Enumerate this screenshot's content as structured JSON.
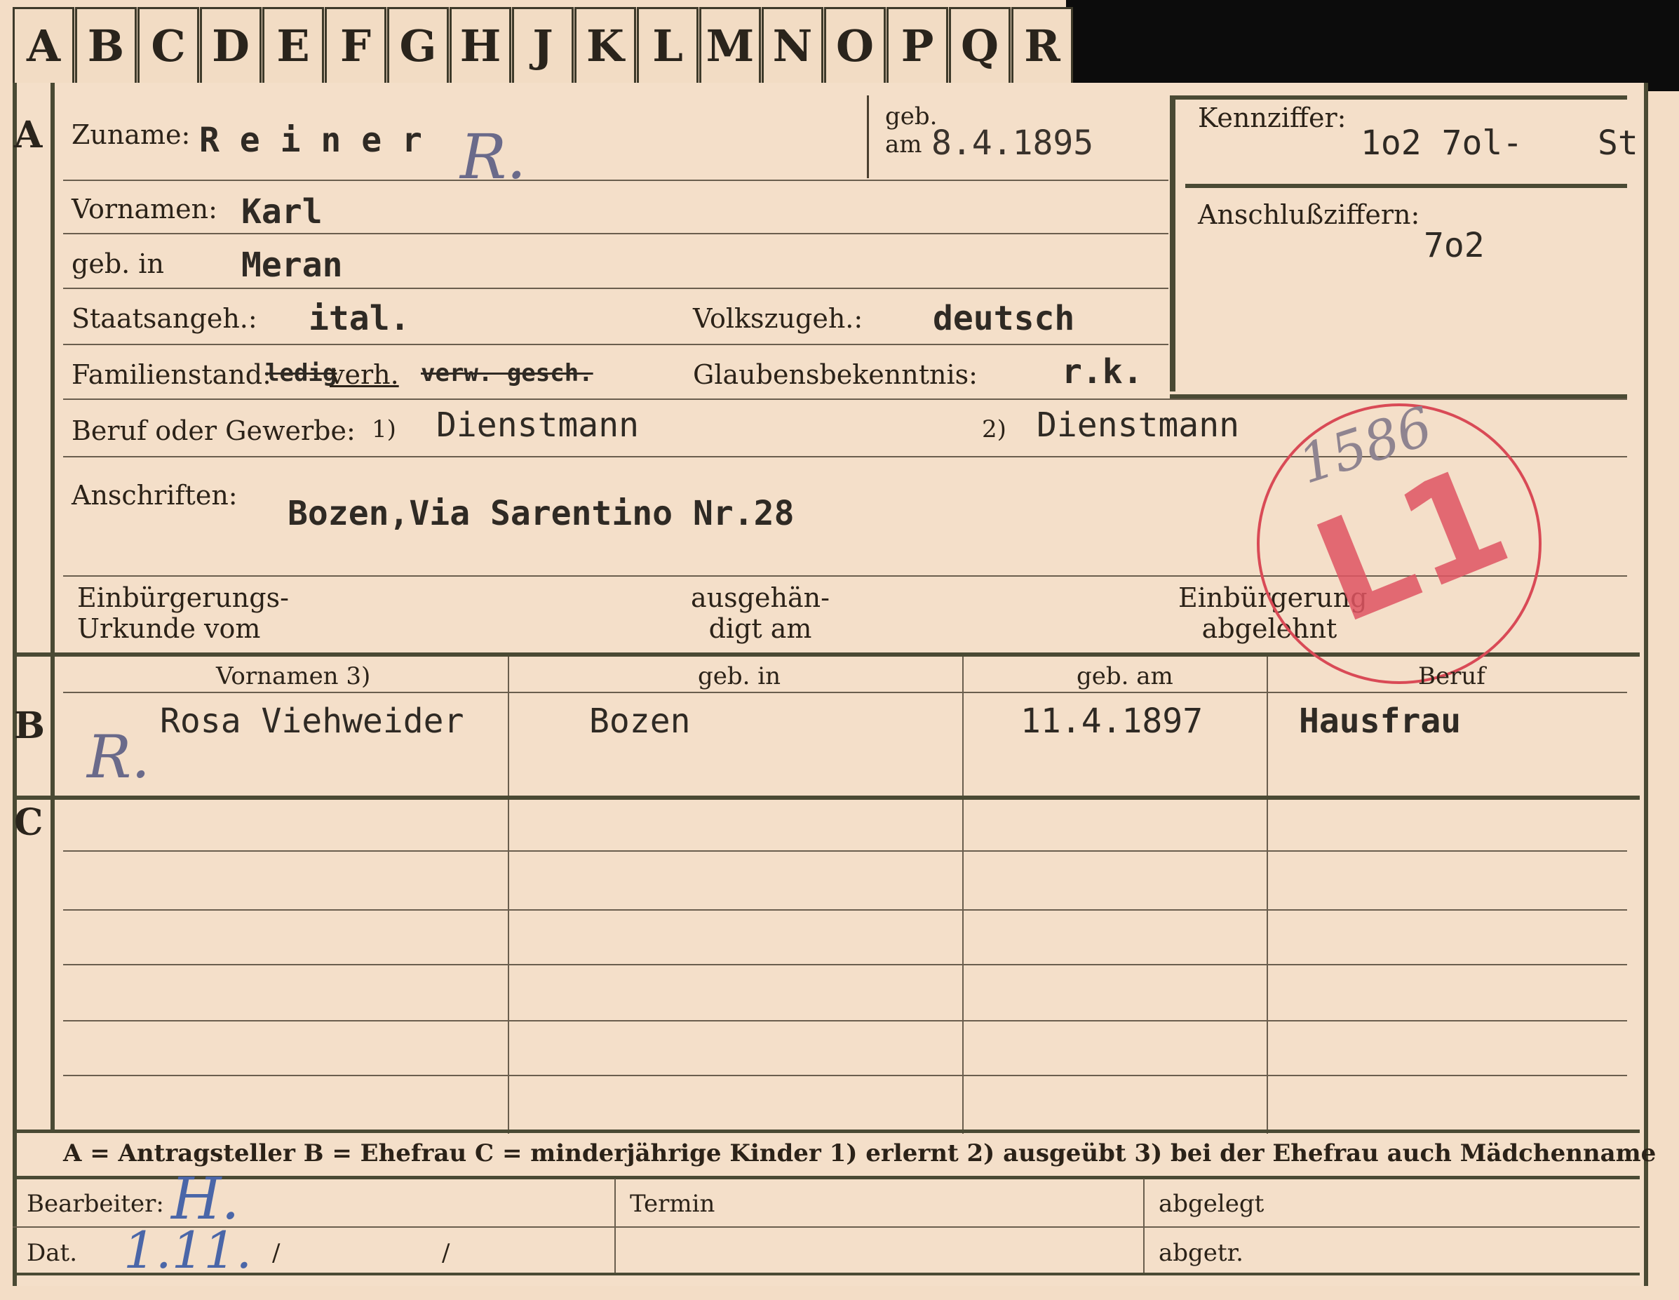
{
  "tabs": [
    "A",
    "B",
    "C",
    "D",
    "E",
    "F",
    "G",
    "H",
    "J",
    "K",
    "L",
    "M",
    "N",
    "O",
    "P",
    "Q",
    "R"
  ],
  "section_letters": {
    "a": "A",
    "b": "B",
    "c": "C"
  },
  "labels": {
    "surname": "Zuname:",
    "born_on": "geb. am",
    "given_names": "Vornamen:",
    "born_in": "geb. in",
    "citizenship": "Staatsangeh.:",
    "ethnicity": "Volkszugeh.:",
    "marital": "Familienstand:",
    "religion": "Glaubensbekenntnis:",
    "occupation": "Beruf oder Gewerbe:",
    "occ_1": "1)",
    "occ_2": "2)",
    "addresses": "Anschriften:",
    "nat_doc": "Einbürgerungs- Urkunde vom",
    "handed": "ausgehän- digt am",
    "nat_refused": "Einbürgerung abgelehnt",
    "id_number": "Kennziffer:",
    "link_numbers": "Anschlußziffern:",
    "wife_given": "Vornamen 3)",
    "wife_born_in": "geb. in",
    "wife_born_on": "geb. am",
    "wife_occ": "Beruf",
    "clerk": "Bearbeiter:",
    "date": "Dat.",
    "date_sep1": "/",
    "date_sep2": "/",
    "appointment": "Termin",
    "filed": "abgelegt",
    "removed": "abgetr."
  },
  "values": {
    "surname": "R e i n e r",
    "born_on": "8.4.1895",
    "given_names": "Karl",
    "born_in": "Meran",
    "citizenship": "ital.",
    "ethnicity": "deutsch",
    "marital_struck_1": "ledig",
    "marital": "verh.",
    "marital_struck_2": "verw. gesch.",
    "religion": "r.k.",
    "occupation_1": "Dienstmann",
    "occupation_2": "Dienstmann",
    "address": "Bozen,Via Sarentino Nr.28",
    "id_number": "1o2 7ol-",
    "id_suffix": "St",
    "link_number": "7o2",
    "wife_given": "Rosa Viehweider",
    "wife_born_in": "Bozen",
    "wife_born_on": "11.4.1897",
    "wife_occ": "Hausfrau"
  },
  "annotations": {
    "initial_a": "R.",
    "initial_b": "R.",
    "stamp_number": "1586",
    "stamp_code": "L1",
    "clerk_mark": "H.",
    "date_mark": "1.11."
  },
  "legend": "A = Antragsteller   B = Ehefrau   C = minderjährige Kinder   1) erlernt   2) ausgeübt   3) bei der Ehefrau auch Mädchenname",
  "colors": {
    "card": "#f4dfc9",
    "stamp": "#d94a56",
    "ink": "#2f2a24",
    "pencil_blue": "#4a66a8"
  }
}
